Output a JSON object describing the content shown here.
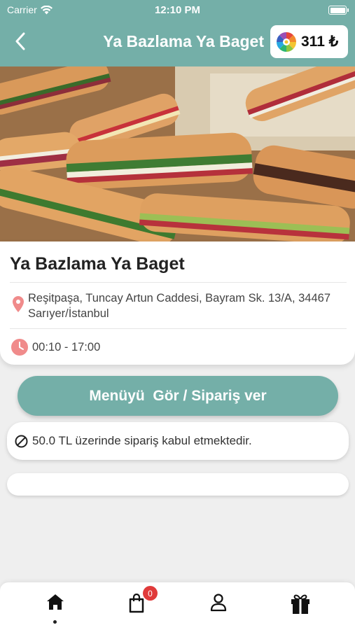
{
  "status_bar": {
    "carrier": "Carrier",
    "time": "12:10 PM"
  },
  "header": {
    "title": "Ya Bazlama Ya Baget",
    "balance": "311 ₺"
  },
  "restaurant": {
    "name": "Ya Bazlama Ya Baget",
    "address": "Reşitpaşa, Tuncay Artun Caddesi, Bayram Sk. 13/A, 34467 Sarıyer/İstanbul",
    "hours": "00:10 - 17:00"
  },
  "menu_button": {
    "label": "Menüyü  Gör / Sipariş ver"
  },
  "notice": {
    "min_order": "50.0 TL üzerinde sipariş kabul etmektedir."
  },
  "tabbar": {
    "cart_count": "0",
    "active_tab": "home"
  },
  "colors": {
    "accent": "#74afa8",
    "pin": "#f08b8b",
    "badge": "#e03a3a",
    "background": "#efefef"
  },
  "icons": [
    "wifi-icon",
    "battery-icon",
    "back-arrow-icon",
    "wheel-icon",
    "location-pin-icon",
    "clock-icon",
    "block-icon",
    "home-icon",
    "shopping-bag-icon",
    "user-icon",
    "gift-icon"
  ]
}
